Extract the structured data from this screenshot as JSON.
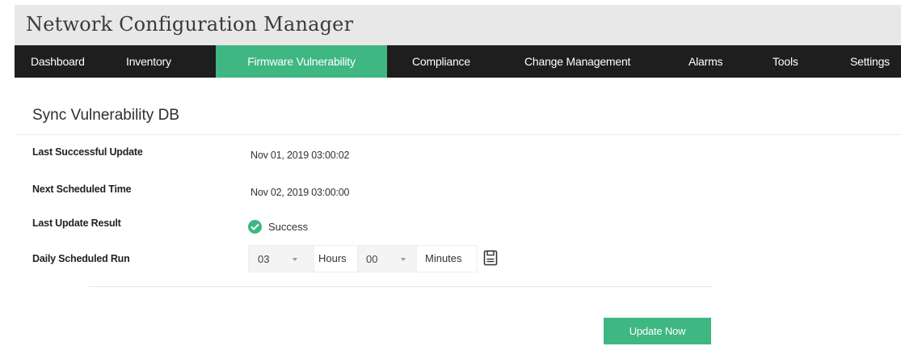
{
  "app": {
    "title": "Network Configuration Manager"
  },
  "nav": {
    "items": [
      {
        "label": "Dashboard"
      },
      {
        "label": "Inventory"
      },
      {
        "label": "Firmware Vulnerability",
        "active": true
      },
      {
        "label": "Compliance"
      },
      {
        "label": "Change Management"
      },
      {
        "label": "Alarms"
      },
      {
        "label": "Tools"
      },
      {
        "label": "Settings"
      }
    ]
  },
  "section": {
    "title": "Sync Vulnerability DB",
    "fields": {
      "last_update": {
        "label": "Last Successful Update",
        "value": "Nov 01, 2019 03:00:02"
      },
      "next_time": {
        "label": "Next Scheduled Time",
        "value": "Nov 02, 2019 03:00:00"
      },
      "last_result": {
        "label": "Last Update Result",
        "value": "Success"
      },
      "daily_run": {
        "label": "Daily Scheduled Run",
        "hours_value": "03",
        "hours_unit": "Hours",
        "minutes_value": "00",
        "minutes_unit": "Minutes"
      }
    },
    "update_button": "Update Now"
  },
  "icons": {
    "status": "check-circle-icon",
    "save": "save-icon",
    "dropdown": "caret-down-icon"
  },
  "colors": {
    "accent": "#3fb783",
    "navbar": "#1e1e1e",
    "titlebar": "#e8e8e8"
  }
}
